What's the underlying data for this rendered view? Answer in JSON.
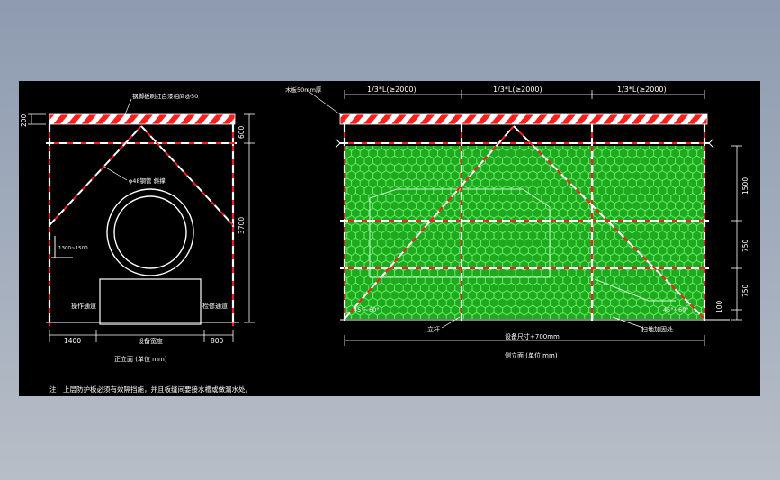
{
  "front_view": {
    "title": "正立面 (单位 mm)",
    "top_label": "钢脚板刷红白漆相间@50",
    "brace_label": "φ48钢管 斜撑",
    "dim_top": "200",
    "dim_600": "600",
    "dim_height": "3700",
    "dim_left": "1400",
    "dim_middle": "设备宽度",
    "dim_right": "800",
    "bar_gap": "1300~1500",
    "left_passage": "操作通道",
    "right_passage": "检修通道"
  },
  "side_view": {
    "title": "侧立面 (单位 mm)",
    "plank_label": "木板50mm厚",
    "span_label": "1/3*L(≥2000)",
    "dim_1500": "1500",
    "dim_750a": "750",
    "dim_750b": "750",
    "dim_100": "100",
    "angle_left": "45°~60°",
    "angle_right": "45°~60°",
    "post_label": "立杆",
    "length_label": "设备尺寸+700mm",
    "sweep_label": "扫地加固处"
  },
  "note": "注：上层防护板必须有效隔挡施，并且板缝间要接水槽或做漏水处。",
  "colors": {
    "background": "#000000",
    "stripe_red": "#ff1e1e",
    "frame_white": "#ffffff",
    "mesh_green": "#21a821",
    "mesh_line": "#6dff6d"
  }
}
